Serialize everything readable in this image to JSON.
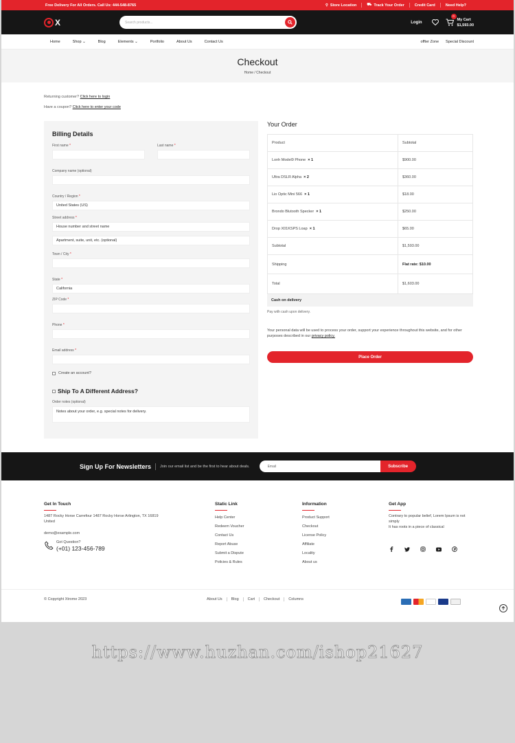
{
  "topbar": {
    "promo": "Free Delivery For All Orders. Call Us: 444-548-8765",
    "links": [
      "Store Location",
      "Track Your Order",
      "Credit Card",
      "Need Help?"
    ]
  },
  "header": {
    "logo_text": "X",
    "search_placeholder": "Search products...",
    "login": "Login",
    "cart_count": "0",
    "cart_label": "My Cart",
    "cart_total": "$1,593.00"
  },
  "nav": {
    "items": [
      "Home",
      "Shop",
      "Blog",
      "Elements",
      "Portfolio",
      "About Us",
      "Contact Us"
    ],
    "right": [
      "offter Zone",
      "Special Discount"
    ]
  },
  "banner": {
    "title": "Checkout",
    "breadcrumb": "Home / Checkout"
  },
  "notices": {
    "returning_prefix": "Returning customer?",
    "returning_link": "Click here to login",
    "coupon_prefix": "Have a coupon?",
    "coupon_link": "Click here to enter your code"
  },
  "billing": {
    "title": "Billing Details",
    "first_name": "First name",
    "last_name": "Last name",
    "company": "Company name (optional)",
    "country_label": "Country / Region",
    "country_value": "United States (US)",
    "street_label": "Street address",
    "street_placeholder1": "House number and street name",
    "street_placeholder2": "Apartment, suite, unit, etc. (optional)",
    "town": "Town / City",
    "state_label": "State",
    "state_value": "California",
    "zip": "ZIP Code",
    "phone": "Phone",
    "email": "Email address",
    "create_account": "Create an account?",
    "ship_different": "Ship To A Different Address?",
    "order_notes_label": "Order notes (optional)",
    "order_notes_placeholder": "Notes about your order, e.g. special notes for delivery.",
    "req": "*"
  },
  "order": {
    "title": "Your Order",
    "col_product": "Product",
    "col_subtotal": "Subtotal",
    "items": [
      {
        "name": "Lonh Model9 Phone",
        "qty": "× 1",
        "subtotal": "$900.00"
      },
      {
        "name": "Ultra DSLR Alpha",
        "qty": "× 2",
        "subtotal": "$360.00"
      },
      {
        "name": "Lio Optic Mini 566",
        "qty": "× 1",
        "subtotal": "$18.00"
      },
      {
        "name": "Brondo Blutooth Specker",
        "qty": "× 1",
        "subtotal": "$250.00"
      },
      {
        "name": "Drop X01KSPS Loap",
        "qty": "× 1",
        "subtotal": "$65.00"
      }
    ],
    "subtotal_label": "Subtotal",
    "subtotal_value": "$1,593.00",
    "shipping_label": "Shipping",
    "shipping_value": "Flat rate: $10.00",
    "total_label": "Total",
    "total_value": "$1,603.00",
    "payment_method": "Cash on delivery",
    "payment_note": "Pay with cash upon delivery.",
    "privacy_text": "Your personal data will be used to process your order, support your experience throughout this website, and for other purposes described in our",
    "privacy_link": "privacy policy.",
    "place_order": "Place Order"
  },
  "newsletter": {
    "title": "Sign Up For Newsletters",
    "text": "Join our email list and be the first to hear about deals.",
    "placeholder": "Email",
    "button": "Subscribe"
  },
  "footer": {
    "touch_title": "Get In Touch",
    "address": "1487 Rocky Horse Carrefour 1487 Rocky Horse Arlington, TX 16819 United",
    "email": "demo@example.com",
    "question": "Got Question?",
    "phone": "(+01) 123-456-789",
    "static_title": "Static Link",
    "static_links": [
      "Help Center",
      "Redeem Voucher",
      "Contact Us",
      "Report Abuse",
      "Submit a Dispute",
      "Policies & Rules"
    ],
    "info_title": "Information",
    "info_links": [
      "Product Support",
      "Checkout",
      "License Policy",
      "Affiliate",
      "Locality",
      "About us"
    ],
    "app_title": "Get App",
    "app_text": "Contrary to popular belief, Lorem Ipsum is not simply",
    "app_text2": "It has roots in a piece of classical",
    "copyright": "© Copyright Xtrome 2023",
    "bottom_links": [
      "About Us",
      "Blog",
      "Cart",
      "Checkout",
      "Columns"
    ],
    "accent": "#e3242b"
  },
  "watermark": "https://www.huzhan.com/ishop21627"
}
